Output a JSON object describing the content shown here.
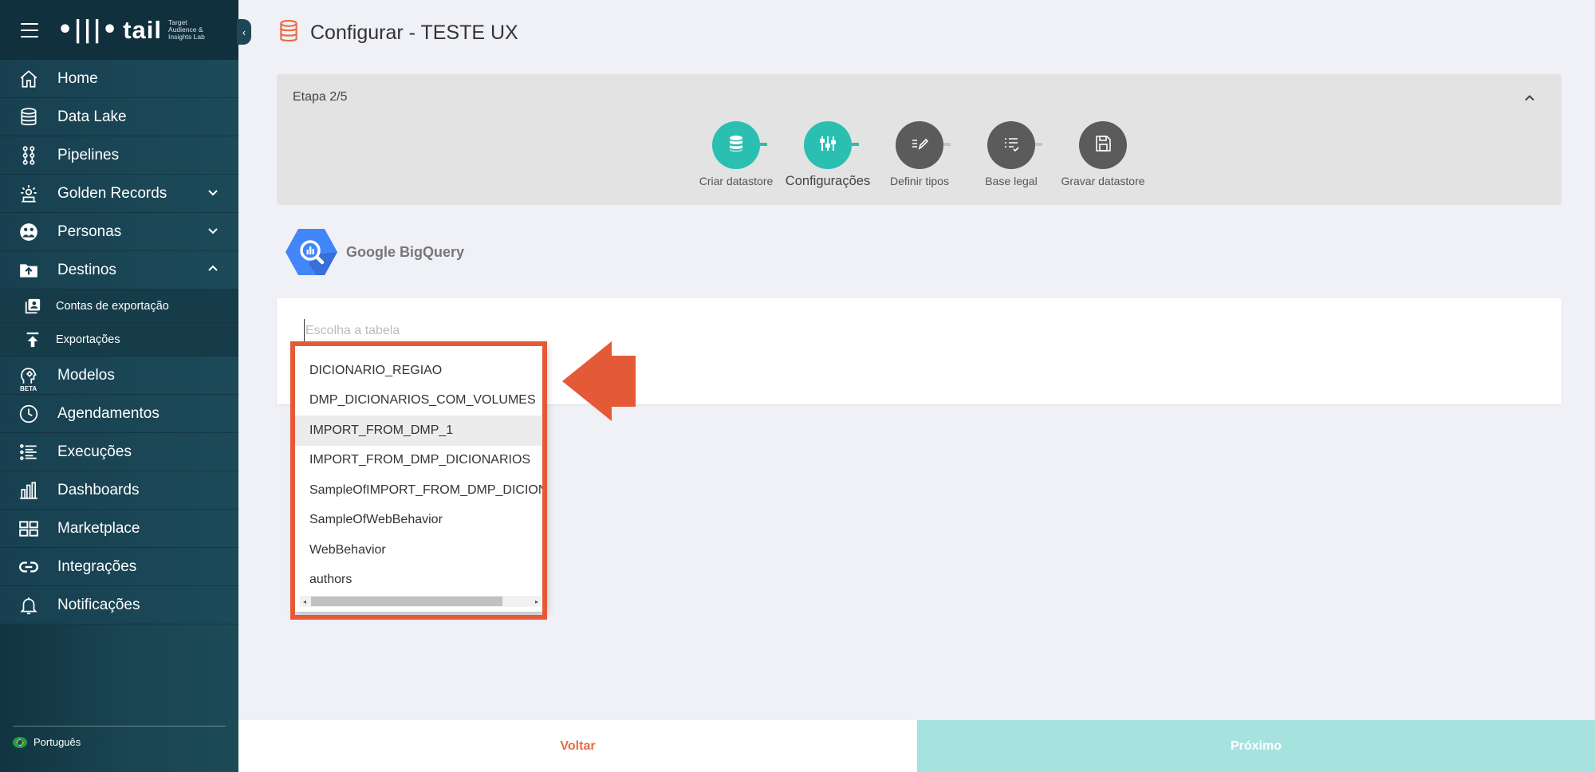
{
  "sidebar": {
    "brand": {
      "logo_mark": "•|||•",
      "name": "tail",
      "tagline": "Target Audience & Insights Lab"
    },
    "collapse_icon": "chevron-left-icon",
    "items": [
      {
        "label": "Home",
        "icon": "home-icon"
      },
      {
        "label": "Data Lake",
        "icon": "database-icon"
      },
      {
        "label": "Pipelines",
        "icon": "pipelines-icon"
      },
      {
        "label": "Golden Records",
        "icon": "golden-records-icon",
        "expand": "down"
      },
      {
        "label": "Personas",
        "icon": "personas-icon",
        "expand": "down"
      },
      {
        "label": "Destinos",
        "icon": "destinos-icon",
        "expand": "up"
      }
    ],
    "sub_items": [
      {
        "label": "Contas de exportação",
        "icon": "accounts-icon"
      },
      {
        "label": "Exportações",
        "icon": "upload-icon"
      }
    ],
    "items_after": [
      {
        "label": "Modelos",
        "icon": "models-icon",
        "badge": "BETA"
      },
      {
        "label": "Agendamentos",
        "icon": "clock-icon"
      },
      {
        "label": "Execuções",
        "icon": "list-icon"
      },
      {
        "label": "Dashboards",
        "icon": "bar-chart-icon"
      },
      {
        "label": "Marketplace",
        "icon": "grid-icon"
      },
      {
        "label": "Integrações",
        "icon": "link-icon"
      },
      {
        "label": "Notificações",
        "icon": "bell-icon"
      }
    ],
    "language": "Português"
  },
  "header": {
    "title": "Configurar - TESTE UX",
    "icon": "database-icon"
  },
  "stepper": {
    "step_text": "Etapa 2/5",
    "steps": [
      {
        "label": "Criar datastore",
        "icon": "database-icon",
        "state": "done"
      },
      {
        "label": "Configurações",
        "icon": "sliders-icon",
        "state": "current"
      },
      {
        "label": "Definir tipos",
        "icon": "edit-list-icon",
        "state": "pending"
      },
      {
        "label": "Base legal",
        "icon": "checklist-icon",
        "state": "pending"
      },
      {
        "label": "Gravar datastore",
        "icon": "save-icon",
        "state": "pending"
      }
    ],
    "colors": {
      "done": "#2bbfb2",
      "pending": "#5b5b5b",
      "line_done": "#2bbfb2",
      "line_pending": "#c4c4c4"
    }
  },
  "datasource": {
    "name": "Google BigQuery",
    "icon": "bigquery-icon"
  },
  "table_select": {
    "placeholder": "Escolha a tabela",
    "value": "",
    "options": [
      "DICIONARIO_REGIAO",
      "DMP_DICIONARIOS_COM_VOLUMES",
      "IMPORT_FROM_DMP_1",
      "IMPORT_FROM_DMP_DICIONARIOS",
      "SampleOfIMPORT_FROM_DMP_DICIONARIOS",
      "SampleOfWebBehavior",
      "WebBehavior",
      "authors"
    ],
    "highlighted_index": 2
  },
  "annotation": {
    "color": "#e55a36"
  },
  "footer": {
    "back_label": "Voltar",
    "next_label": "Próximo"
  }
}
